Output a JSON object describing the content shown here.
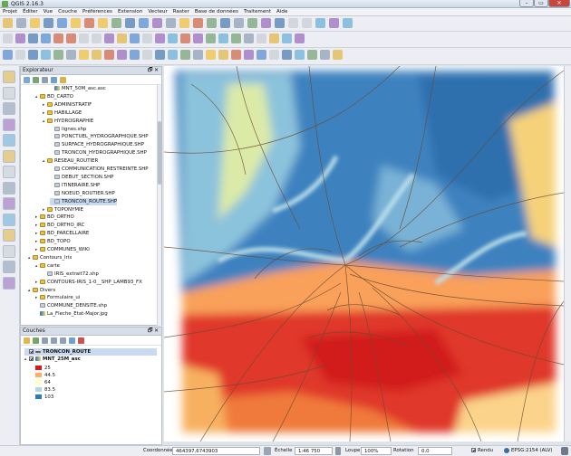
{
  "app": {
    "title": "QGIS 2.16.3"
  },
  "menu": [
    "Projet",
    "Éditer",
    "Vue",
    "Couche",
    "Préférences",
    "Extension",
    "Vecteur",
    "Raster",
    "Base de données",
    "Traitement",
    "Aide"
  ],
  "explorer": {
    "title": "Explorateur",
    "items": [
      {
        "label": "MNT_50M_asc.asc",
        "kind": "raster",
        "indent": 3,
        "arrow": ""
      },
      {
        "label": "BD_CARTO",
        "kind": "folder",
        "indent": 1,
        "arrow": "▴"
      },
      {
        "label": "ADMINISTRATIF",
        "kind": "folder",
        "indent": 2,
        "arrow": "▸"
      },
      {
        "label": "HABILLAGE",
        "kind": "folder",
        "indent": 2,
        "arrow": "▸"
      },
      {
        "label": "HYDROGRAPHIE",
        "kind": "folder",
        "indent": 2,
        "arrow": "▴"
      },
      {
        "label": "lignes.shp",
        "kind": "shp",
        "indent": 3,
        "arrow": ""
      },
      {
        "label": "PONCTUEL_HYDROGRAPHIQUE.SHP",
        "kind": "shp",
        "indent": 3,
        "arrow": ""
      },
      {
        "label": "SURFACE_HYDROGRAPHIQUE.SHP",
        "kind": "shp",
        "indent": 3,
        "arrow": ""
      },
      {
        "label": "TRONCON_HYDROGRAPHIQUE.SHP",
        "kind": "shp",
        "indent": 3,
        "arrow": ""
      },
      {
        "label": "RESEAU_ROUTIER",
        "kind": "folder",
        "indent": 2,
        "arrow": "▴"
      },
      {
        "label": "COMMUNICATION_RESTREINTE.SHP",
        "kind": "shp",
        "indent": 3,
        "arrow": ""
      },
      {
        "label": "DEBUT_SECTION.SHP",
        "kind": "shp",
        "indent": 3,
        "arrow": ""
      },
      {
        "label": "ITINERAIRE.SHP",
        "kind": "shp",
        "indent": 3,
        "arrow": ""
      },
      {
        "label": "NOEUD_ROUTIER.SHP",
        "kind": "shp",
        "indent": 3,
        "arrow": ""
      },
      {
        "label": "TRONCON_ROUTE.SHP",
        "kind": "shp",
        "indent": 3,
        "arrow": "",
        "selected": true
      },
      {
        "label": "TOPONYMIE",
        "kind": "folder",
        "indent": 2,
        "arrow": "▸"
      },
      {
        "label": "BD_ORTHO",
        "kind": "folder",
        "indent": 1,
        "arrow": "▸"
      },
      {
        "label": "BD_ORTHO_IRC",
        "kind": "folder",
        "indent": 1,
        "arrow": "▸"
      },
      {
        "label": "BD_PARCELLAIRE",
        "kind": "folder",
        "indent": 1,
        "arrow": "▸"
      },
      {
        "label": "BD_TOPO",
        "kind": "folder",
        "indent": 1,
        "arrow": "▸"
      },
      {
        "label": "COMMUNES_WIKI",
        "kind": "folder",
        "indent": 1,
        "arrow": "▸"
      },
      {
        "label": "Contours_Iris",
        "kind": "folder",
        "indent": 0,
        "arrow": "▴"
      },
      {
        "label": "carte",
        "kind": "folder",
        "indent": 1,
        "arrow": "▴"
      },
      {
        "label": "IRIS_extrait72.shp",
        "kind": "shp",
        "indent": 2,
        "arrow": ""
      },
      {
        "label": "CONTOURS-IRIS_1-0__SHP_LAMB93_FX",
        "kind": "folder",
        "indent": 1,
        "arrow": "▸"
      },
      {
        "label": "Divers",
        "kind": "folder",
        "indent": 0,
        "arrow": "▴"
      },
      {
        "label": "Formulaire_ui",
        "kind": "folder",
        "indent": 1,
        "arrow": "▸"
      },
      {
        "label": "COMMUNE_DENSITE.shp",
        "kind": "shp",
        "indent": 1,
        "arrow": ""
      },
      {
        "label": "La_Fleche_Etat-Major.jpg",
        "kind": "raster",
        "indent": 1,
        "arrow": ""
      }
    ]
  },
  "layers": {
    "title": "Couches",
    "items": [
      {
        "label": "TRONCON_ROUTE",
        "checked": true,
        "kind": "line"
      },
      {
        "label": "MNT_25M_asc",
        "checked": true,
        "kind": "raster"
      }
    ],
    "legend": [
      {
        "label": "25",
        "color": "#d7191c"
      },
      {
        "label": "44.5",
        "color": "#fdae61"
      },
      {
        "label": "64",
        "color": "#ffffbf"
      },
      {
        "label": "83.5",
        "color": "#abd9e9"
      },
      {
        "label": "103",
        "color": "#2c7bb6"
      }
    ]
  },
  "status": {
    "coord_label": "Coordonnée",
    "coord_value": "464397,6743903",
    "scale_label": "Échelle",
    "scale_value": "1:46 750",
    "zoom_label": "Loupe",
    "zoom_value": "100%",
    "rotation_label": "Rotation",
    "rotation_value": "0,0",
    "render_label": "Rendu",
    "crs": "EPSG:2154 (ALV)"
  }
}
